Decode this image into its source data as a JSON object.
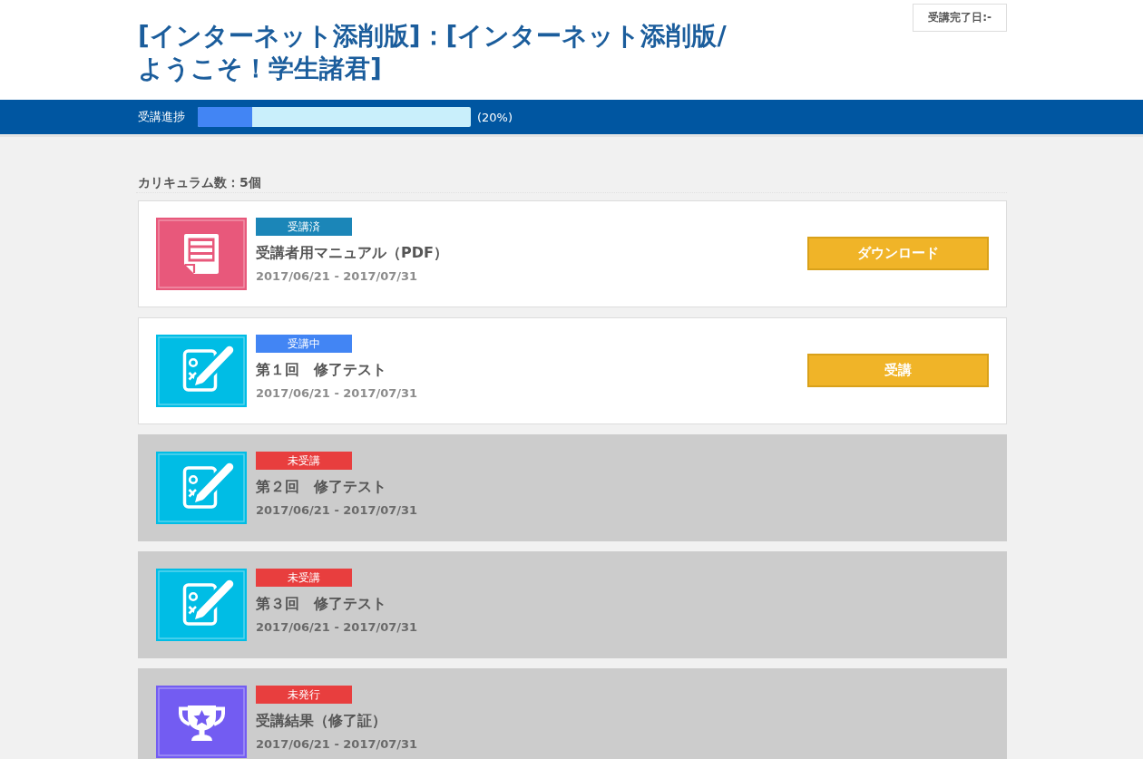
{
  "header": {
    "title_lines": [
      "[インターネット添削版]：[インターネット添削版/",
      "ようこそ！学生諸君]"
    ],
    "completion_date": "受講完了日:-"
  },
  "progress": {
    "label": "受講進捗",
    "level": 0.2,
    "reading": "(20%)"
  },
  "curriculum": {
    "count": "カリキュラム数：5個",
    "items": [
      {
        "kind": "document",
        "available": true,
        "badge": {
          "text": "受講済",
          "color": "#1b86b8"
        },
        "title": "受講者用マニュアル（PDF）",
        "period": "2017/06/21 - 2017/07/31",
        "button": "ダウンロード"
      },
      {
        "kind": "test",
        "available": true,
        "badge": {
          "text": "受講中",
          "color": "#4285f4"
        },
        "title": "第１回　修了テスト",
        "period": "2017/06/21 - 2017/07/31",
        "button": "受講"
      },
      {
        "kind": "test",
        "available": false,
        "badge": {
          "text": "未受講",
          "color": "#e83e3e"
        },
        "title": "第２回　修了テスト",
        "period": "2017/06/21 - 2017/07/31"
      },
      {
        "kind": "test",
        "available": false,
        "badge": {
          "text": "未受講",
          "color": "#e83e3e"
        },
        "title": "第３回　修了テスト",
        "period": "2017/06/21 - 2017/07/31"
      },
      {
        "kind": "certificate",
        "available": false,
        "badge": {
          "text": "未発行",
          "color": "#e83e3e"
        },
        "title": "受講結果（修了証）",
        "period": "2017/06/21 - 2017/07/31"
      }
    ]
  }
}
